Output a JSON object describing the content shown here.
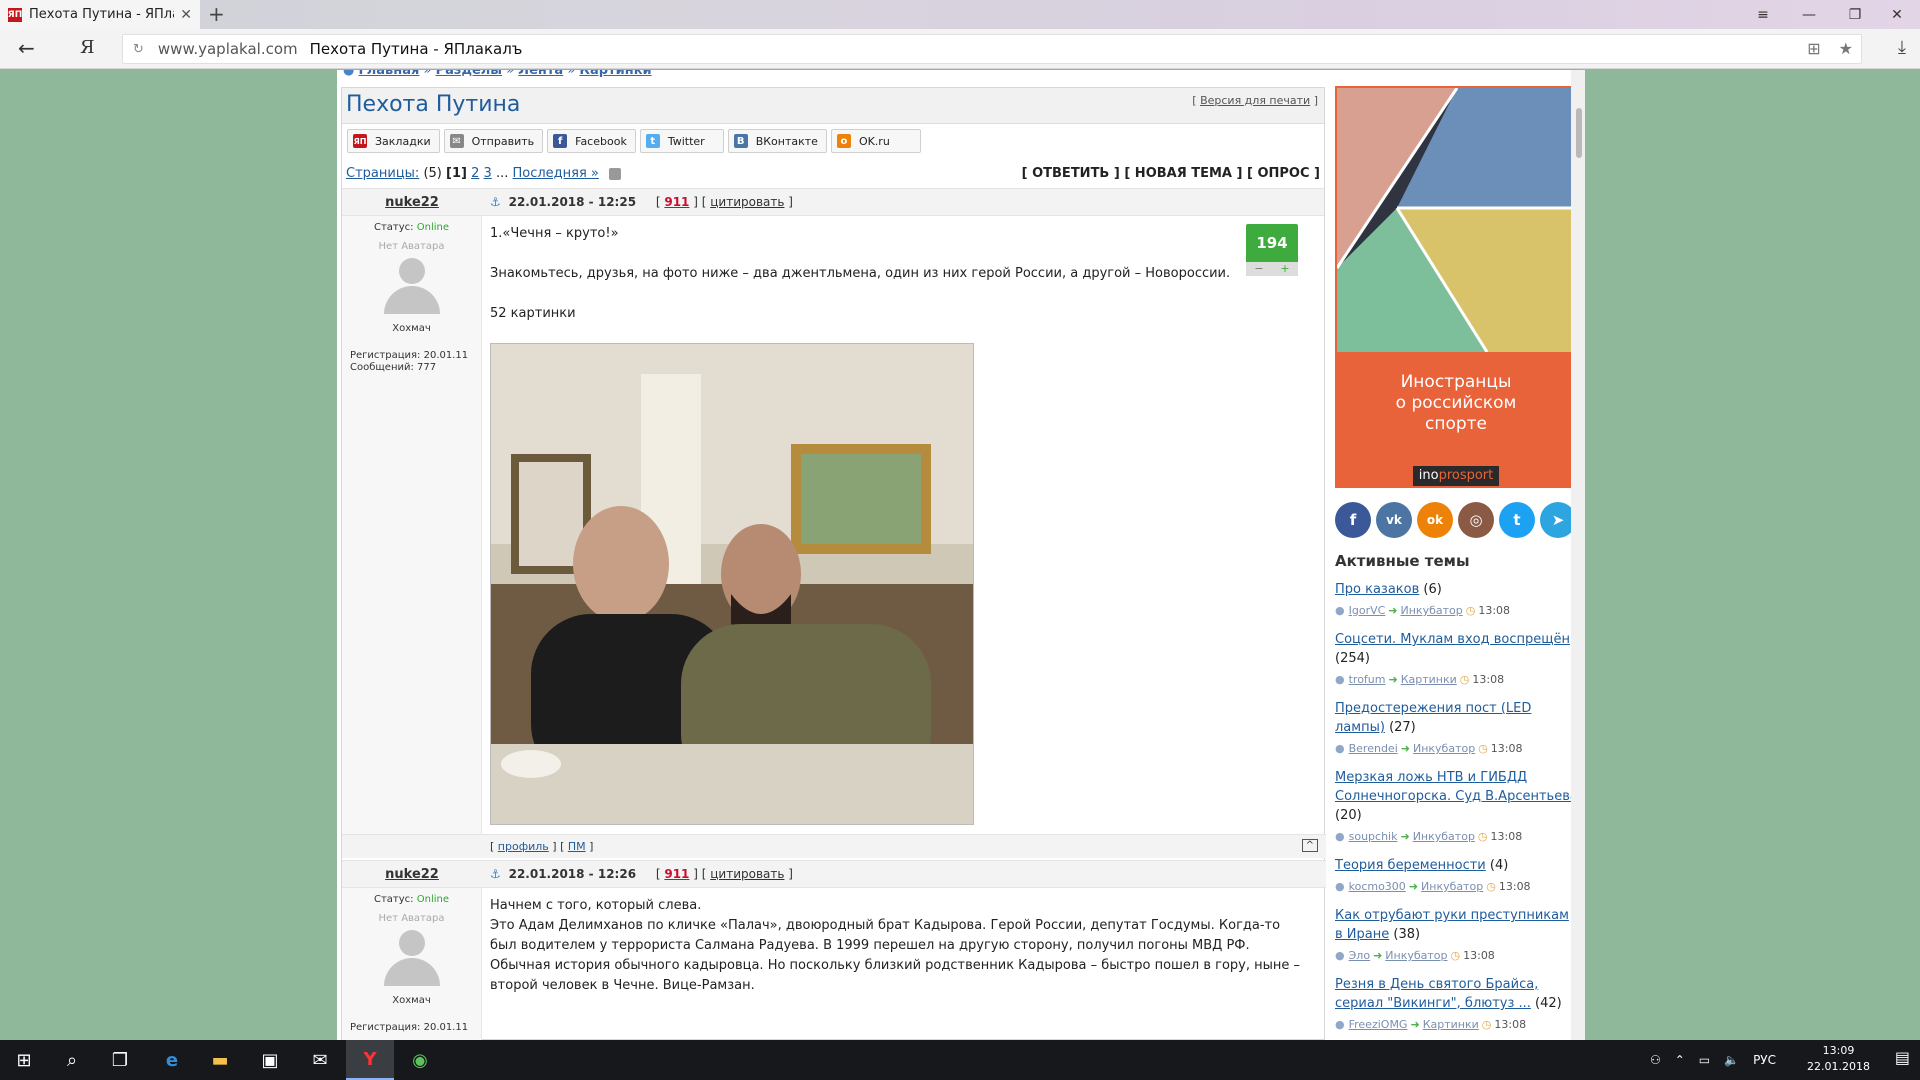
{
  "browser": {
    "tab_title": "Пехота Путина - ЯПлакаЛ",
    "tab_favicon": "ЯП",
    "url_domain": "www.yaplakal.com",
    "url_title": "Пехота Путина - ЯПлакалъ",
    "ya_logo": "Я"
  },
  "breadcrumb": [
    "Главная",
    "Разделы",
    "Лента",
    "Картинки"
  ],
  "topic": {
    "title": "Пехота Путина",
    "print_link": "Версия для печати"
  },
  "share": [
    {
      "label": "Закладки",
      "icon": "ЯП",
      "color": "#c4161c"
    },
    {
      "label": "Отправить",
      "icon": "✉",
      "color": "#888888"
    },
    {
      "label": "Facebook",
      "icon": "f",
      "color": "#3b5998"
    },
    {
      "label": "Twitter",
      "icon": "t",
      "color": "#55acee"
    },
    {
      "label": "ВКонтакте",
      "icon": "В",
      "color": "#4c75a3"
    },
    {
      "label": "OK.ru",
      "icon": "о",
      "color": "#ee8208"
    }
  ],
  "pagination": {
    "label": "Страницы:",
    "count": "(5)",
    "current": "[1]",
    "p2": "2",
    "p3": "3",
    "dots": "...",
    "last": "Последняя »"
  },
  "actions": {
    "reply": "[ ОТВЕТИТЬ ]",
    "new_topic": "[ НОВАЯ ТЕМА ]",
    "poll": "[ ОПРОС ]"
  },
  "posts": [
    {
      "author": "nuke22",
      "date": "22.01.2018 - 12:25",
      "num": "911",
      "cite": "цитировать",
      "status_label": "Статус:",
      "status": "Online",
      "avatar_text": "Нет Аватара",
      "rank": "Хохмач",
      "reg": "Регистрация: 20.01.11",
      "msgs": "Сообщений: 777",
      "lines": [
        "1.«Чечня – круто!»",
        "Знакомьтесь, друзья, на фото ниже – два джентльмена, один из них герой России, а другой – Новороссии.",
        "52 картинки"
      ],
      "rating": "194",
      "rating_minus": "−",
      "rating_plus": "+",
      "profile": "профиль",
      "pm": "ПМ",
      "up": "^"
    },
    {
      "author": "nuke22",
      "date": "22.01.2018 - 12:26",
      "num": "911",
      "cite": "цитировать",
      "status_label": "Статус:",
      "status": "Online",
      "avatar_text": "Нет Аватара",
      "rank": "Хохмач",
      "reg": "Регистрация: 20.01.11",
      "lines": [
        "Начнем с того, который слева.",
        "Это Адам Делимханов по кличке «Палач», двоюродный брат Кадырова. Герой России, депутат Госдумы. Когда-то был водителем у террориста Салмана Радуева. В 1999 перешел на другую сторону, получил погоны МВД РФ. Обычная история обычного кадыровца. Но поскольку близкий родственник Кадырова – быстро пошел в гору, ныне – второй человек в Чечне. Вице-Рамзан."
      ]
    }
  ],
  "ad": {
    "text1": "Иностранцы",
    "text2": "о российском",
    "text3": "спорте",
    "brand_a": "ino",
    "brand_b": "prosport"
  },
  "social": [
    {
      "name": "facebook",
      "glyph": "f",
      "color": "#3b5998"
    },
    {
      "name": "vk",
      "glyph": "vk",
      "color": "#4c75a3"
    },
    {
      "name": "ok",
      "glyph": "ok",
      "color": "#ee8208"
    },
    {
      "name": "instagram",
      "glyph": "◎",
      "color": "#8a5a44"
    },
    {
      "name": "twitter",
      "glyph": "t",
      "color": "#1da1f2"
    },
    {
      "name": "telegram",
      "glyph": "➤",
      "color": "#2ca5e0"
    }
  ],
  "active_topics": {
    "title": "Активные темы",
    "items": [
      {
        "title": "Про казаков",
        "count": "(6)",
        "user": "IgorVC",
        "section": "Инкубатор",
        "time": "13:08"
      },
      {
        "title": "Соцсети. Муклам вход воспрещён",
        "count": "(254)",
        "user": "trofum",
        "section": "Картинки",
        "time": "13:08"
      },
      {
        "title": "Предостережения пост (LED лампы)",
        "count": "(27)",
        "user": "Berendei",
        "section": "Инкубатор",
        "time": "13:08"
      },
      {
        "title": "Мерзкая ложь НТВ и ГИБДД Солнечногорска. Суд В.Арсентьева",
        "count": "(20)",
        "user": "soupchik",
        "section": "Инкубатор",
        "time": "13:08"
      },
      {
        "title": "Теория беременности",
        "count": "(4)",
        "user": "kocmo300",
        "section": "Инкубатор",
        "time": "13:08"
      },
      {
        "title": "Как отрубают руки преступникам в Иране",
        "count": "(38)",
        "user": "Эло",
        "section": "Инкубатор",
        "time": "13:08"
      },
      {
        "title": "Резня в День святого Брайса, сериал \"Викинги\", блютуз ...",
        "count": "(42)",
        "user": "FreeziOMG",
        "section": "Картинки",
        "time": "13:08"
      }
    ]
  },
  "taskbar": {
    "lang": "РУС",
    "time": "13:09",
    "date": "22.01.2018"
  }
}
